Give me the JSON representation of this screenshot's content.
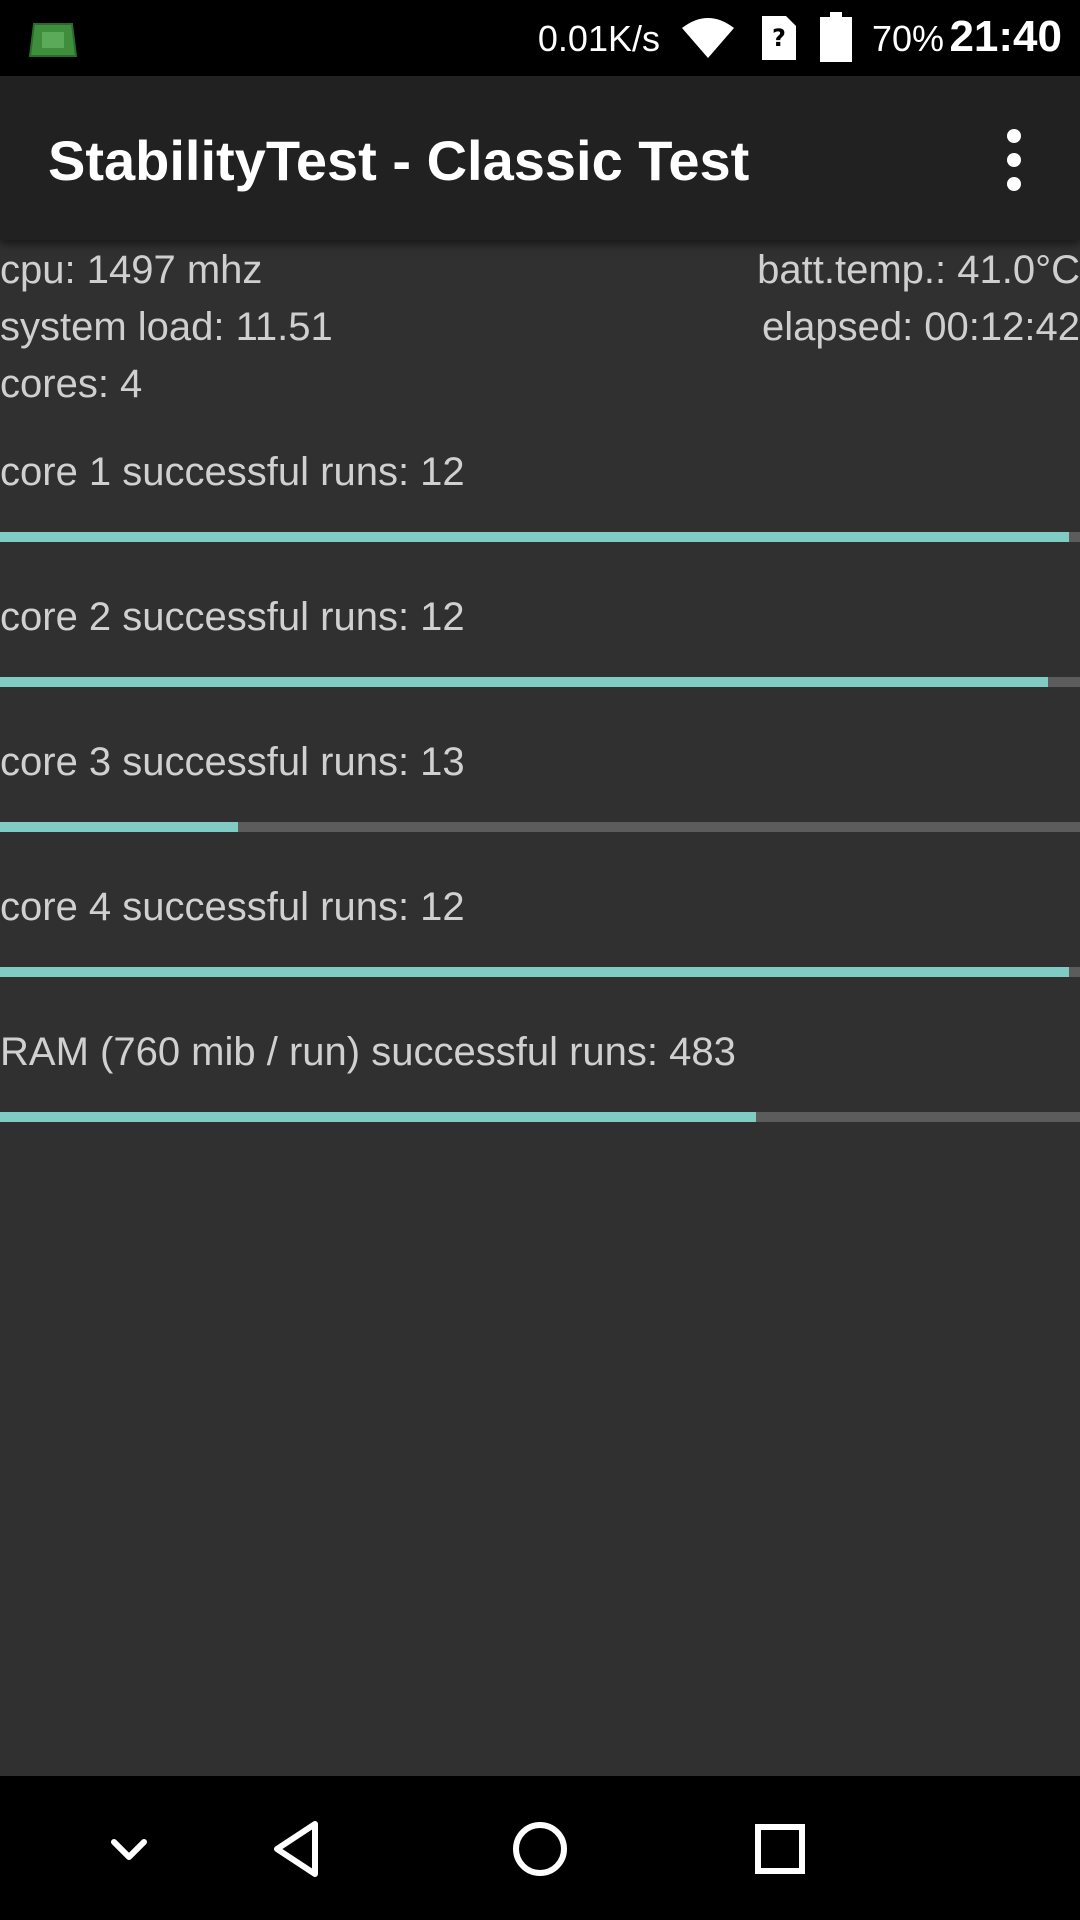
{
  "status_bar": {
    "net_speed": "0.01K/s",
    "battery_percent": "70%",
    "time": "21:40",
    "icons": [
      "stabilitytest-app-icon",
      "wifi-icon",
      "sim-unknown-icon",
      "battery-icon"
    ]
  },
  "app_bar": {
    "title": "StabilityTest - Classic Test",
    "menu_icon": "more-vert-icon"
  },
  "info": {
    "cpu": "cpu: 1497 mhz",
    "batt_temp": "batt.temp.: 41.0°C",
    "system_load": "system load: 11.51",
    "elapsed": "elapsed: 00:12:42",
    "cores": "cores: 4"
  },
  "progress_items": [
    {
      "label": "core 1 successful runs: 12",
      "progress": 0.99
    },
    {
      "label": "core 2 successful runs: 12",
      "progress": 0.97
    },
    {
      "label": "core 3 successful runs: 13",
      "progress": 0.22
    },
    {
      "label": "core 4 successful runs: 12",
      "progress": 0.99
    },
    {
      "label": "RAM (760 mib / run) successful runs: 483",
      "progress": 0.7
    }
  ],
  "nav_bar": {
    "icons": [
      "chevron-down-icon",
      "back-icon",
      "home-icon",
      "recents-icon"
    ]
  },
  "colors": {
    "background": "#303030",
    "appbar": "#212121",
    "accent": "#80cbc4",
    "track": "#5c5c5c"
  }
}
